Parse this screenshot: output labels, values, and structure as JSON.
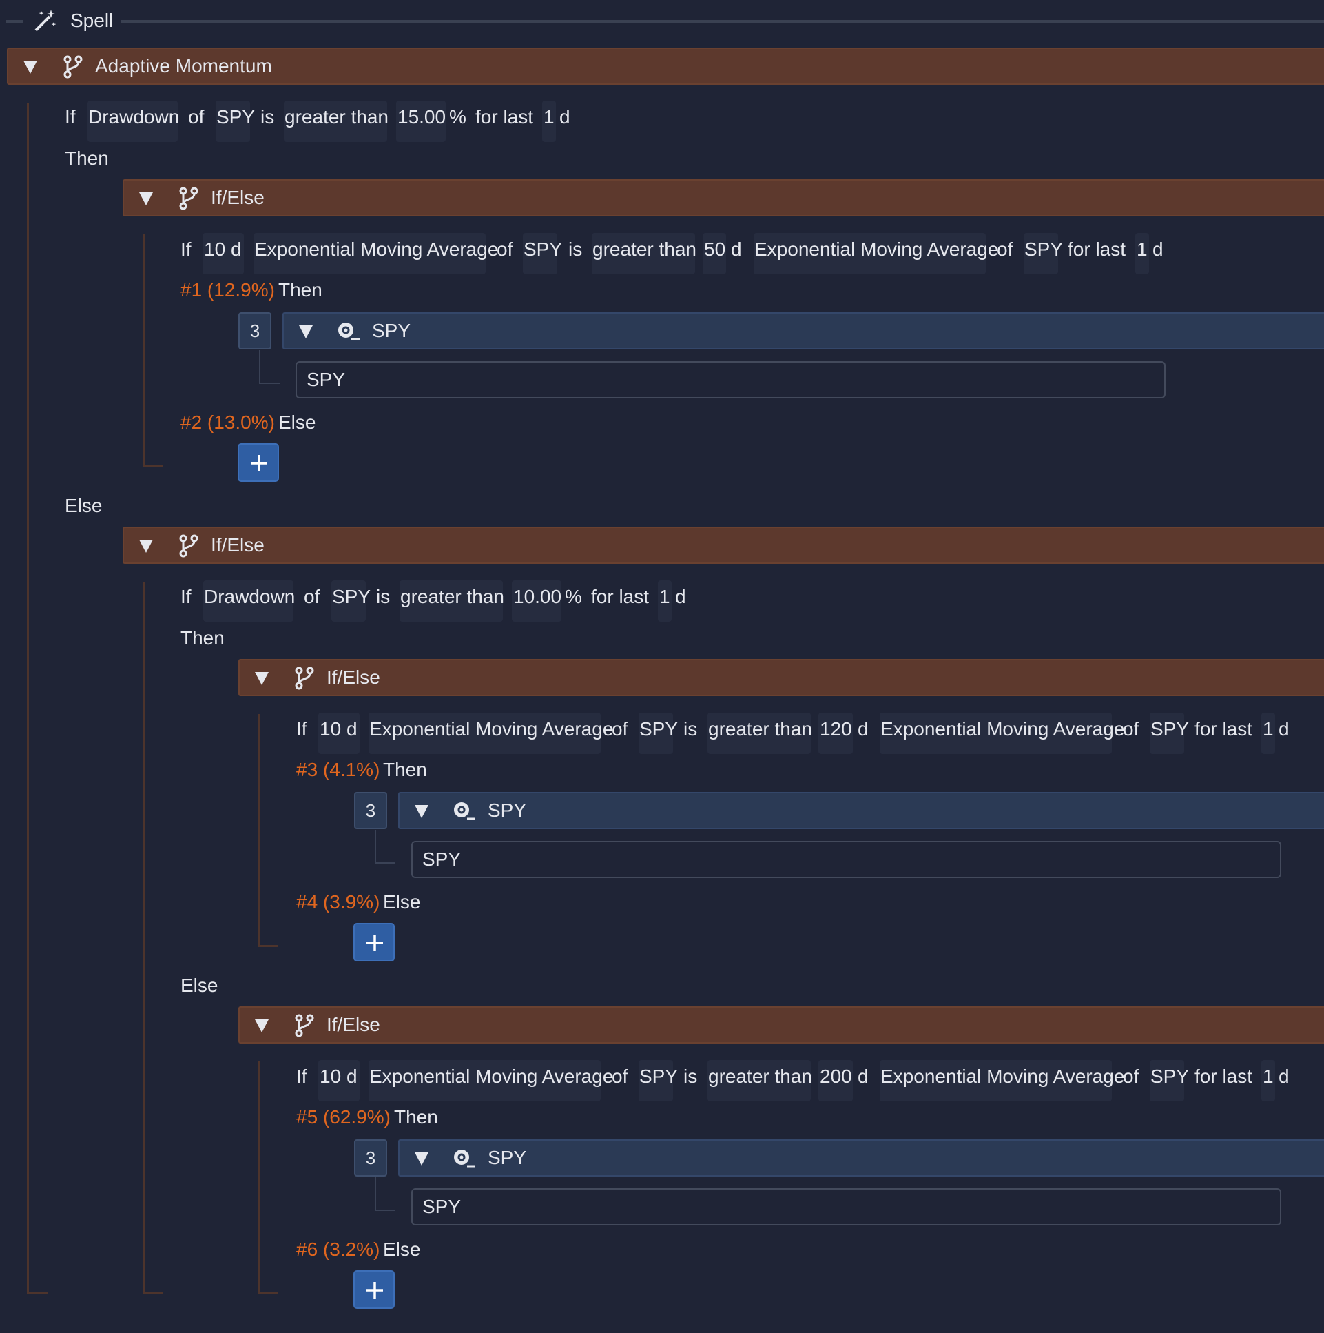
{
  "spell": {
    "label": "Spell"
  },
  "root": {
    "title": "Adaptive Momentum"
  },
  "cond_root": {
    "if": "If",
    "indicator": "Drawdown",
    "of": "of",
    "asset": "SPY",
    "is": "is",
    "comparator": "greater than",
    "value": "15.00",
    "unit": "%",
    "for_last": "for last",
    "period_value": "1",
    "period_unit": "d"
  },
  "then_label": "Then",
  "else_label": "Else",
  "ifelse_title": "If/Else",
  "block_a": {
    "cond": {
      "if": "If",
      "n1": "10",
      "d1": "d",
      "ind1": "Exponential Moving Average",
      "of1": "of",
      "asset1": "SPY",
      "is": "is",
      "comparator": "greater than",
      "n2": "50",
      "d2": "d",
      "ind2": "Exponential Moving Average",
      "of2": "of",
      "asset2": "SPY",
      "for_last": "for last",
      "period_value": "1",
      "period_unit": "d"
    },
    "then_tag": "#1 (12.9%)",
    "else_tag": "#2 (13.0%)",
    "weight": "3",
    "asset_title": "SPY",
    "ticker": "SPY"
  },
  "block_b": {
    "cond": {
      "if": "If",
      "indicator": "Drawdown",
      "of": "of",
      "asset": "SPY",
      "is": "is",
      "comparator": "greater than",
      "value": "10.00",
      "unit": "%",
      "for_last": "for last",
      "period_value": "1",
      "period_unit": "d"
    }
  },
  "block_c": {
    "cond": {
      "if": "If",
      "n1": "10",
      "d1": "d",
      "ind1": "Exponential Moving Average",
      "of1": "of",
      "asset1": "SPY",
      "is": "is",
      "comparator": "greater than",
      "n2": "120",
      "d2": "d",
      "ind2": "Exponential Moving Average",
      "of2": "of",
      "asset2": "SPY",
      "for_last": "for last",
      "period_value": "1",
      "period_unit": "d"
    },
    "then_tag": "#3 (4.1%)",
    "else_tag": "#4 (3.9%)",
    "weight": "3",
    "asset_title": "SPY",
    "ticker": "SPY"
  },
  "block_d": {
    "cond": {
      "if": "If",
      "n1": "10",
      "d1": "d",
      "ind1": "Exponential Moving Average",
      "of1": "of",
      "asset1": "SPY",
      "is": "is",
      "comparator": "greater than",
      "n2": "200",
      "d2": "d",
      "ind2": "Exponential Moving Average",
      "of2": "of",
      "asset2": "SPY",
      "for_last": "for last",
      "period_value": "1",
      "period_unit": "d"
    },
    "then_tag": "#5 (62.9%)",
    "else_tag": "#6 (3.2%)",
    "weight": "3",
    "asset_title": "SPY",
    "ticker": "SPY"
  },
  "icons": {
    "spell": "magic-wand-icon",
    "collapse": "triangle-down-icon",
    "branch": "git-branch-icon",
    "asset": "magnifier-icon",
    "add": "plus-icon"
  },
  "colors": {
    "background": "#1f2436",
    "block_header": "#5d392d",
    "asset_header": "#2b3a55",
    "accent_orange": "#e0661f",
    "add_button": "#2f5ea3"
  }
}
